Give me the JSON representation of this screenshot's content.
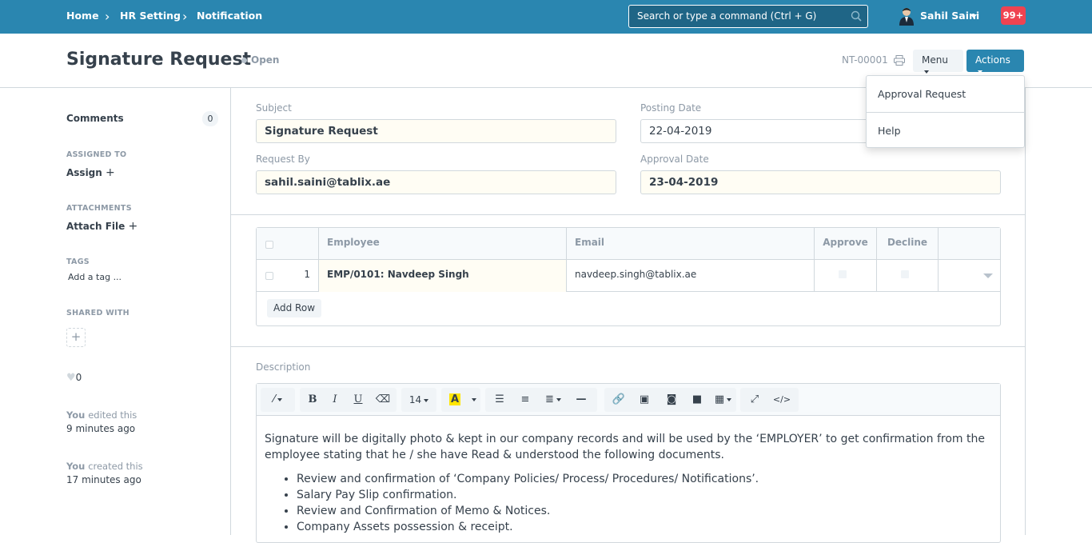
{
  "breadcrumbs": [
    "Home",
    "HR Setting",
    "Notification"
  ],
  "search": {
    "placeholder": "Search or type a command (Ctrl + G)"
  },
  "user": {
    "name": "Sahil Saini",
    "notifications": "99+"
  },
  "page": {
    "title": "Signature Request",
    "status": "Open",
    "doc_id": "NT-00001",
    "menu_label": "Menu",
    "actions_label": "Actions"
  },
  "actions_menu": {
    "items": [
      "Approval Request",
      "Help"
    ]
  },
  "sidebar": {
    "comments_label": "Comments",
    "comments_count": "0",
    "assigned_to_label": "ASSIGNED TO",
    "assign_label": "Assign",
    "attachments_label": "ATTACHMENTS",
    "attach_label": "Attach File",
    "tags_label": "TAGS",
    "tag_placeholder": "Add a tag ...",
    "shared_with_label": "SHARED WITH",
    "likes": "0",
    "timeline": [
      {
        "who": "You",
        "what": "edited this",
        "when": "9 minutes ago"
      },
      {
        "who": "You",
        "what": "created this",
        "when": "17 minutes ago"
      }
    ]
  },
  "form": {
    "subject_label": "Subject",
    "subject": "Signature Request",
    "posting_date_label": "Posting Date",
    "posting_date": "22-04-2019",
    "request_by_label": "Request By",
    "request_by": "sahil.saini@tablix.ae",
    "approval_date_label": "Approval Date",
    "approval_date": "23-04-2019"
  },
  "table": {
    "headers": {
      "employee": "Employee",
      "email": "Email",
      "approve": "Approve",
      "decline": "Decline"
    },
    "rows": [
      {
        "idx": "1",
        "employee": "EMP/0101: Navdeep Singh",
        "email": "navdeep.singh@tablix.ae"
      }
    ],
    "add_row_label": "Add Row"
  },
  "description": {
    "label": "Description",
    "font_size": "14",
    "paragraph": "Signature will be digitally photo & kept in our company records and will be used by the ‘EMPLOYER’ to get confirmation from the employee stating that he / she have Read & understood the following documents.",
    "bullets": [
      "Review and confirmation of ‘Company Policies/ Process/ Procedures/ Notifications’.",
      "Salary Pay Slip confirmation.",
      "Review and Confirmation of Memo & Notices.",
      "Company Assets possession & receipt."
    ]
  },
  "colors": {
    "brand": "#2a86b0",
    "badge": "#ef4351"
  }
}
